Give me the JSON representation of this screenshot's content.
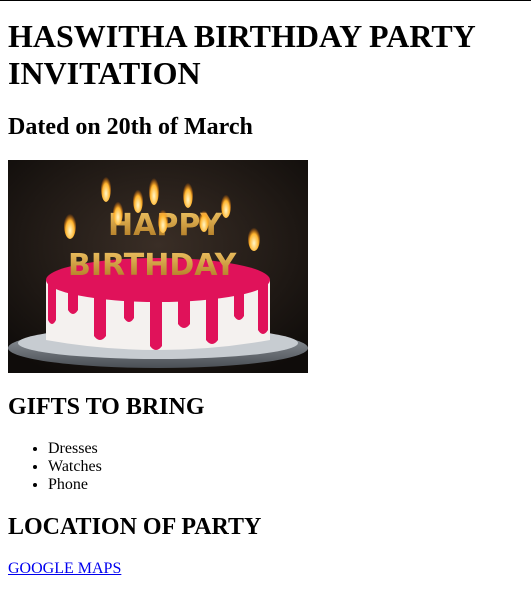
{
  "invitation": {
    "title": "HASWITHA BIRTHDAY PARTY INVITATION",
    "date_heading": "Dated on 20th of March"
  },
  "image": {
    "icon": "birthday-cake-image",
    "banner_text": "HAPPY BIRTHDAY"
  },
  "gifts": {
    "heading": "GIFTS TO BRING",
    "items": [
      "Dresses",
      "Watches",
      "Phone"
    ]
  },
  "location": {
    "heading": "LOCATION OF PARTY",
    "link_label": "GOOGLE MAPS"
  },
  "colors": {
    "link": "#0000ee",
    "frosting": "#e0125a",
    "candle_gold": "#d99a2b"
  }
}
